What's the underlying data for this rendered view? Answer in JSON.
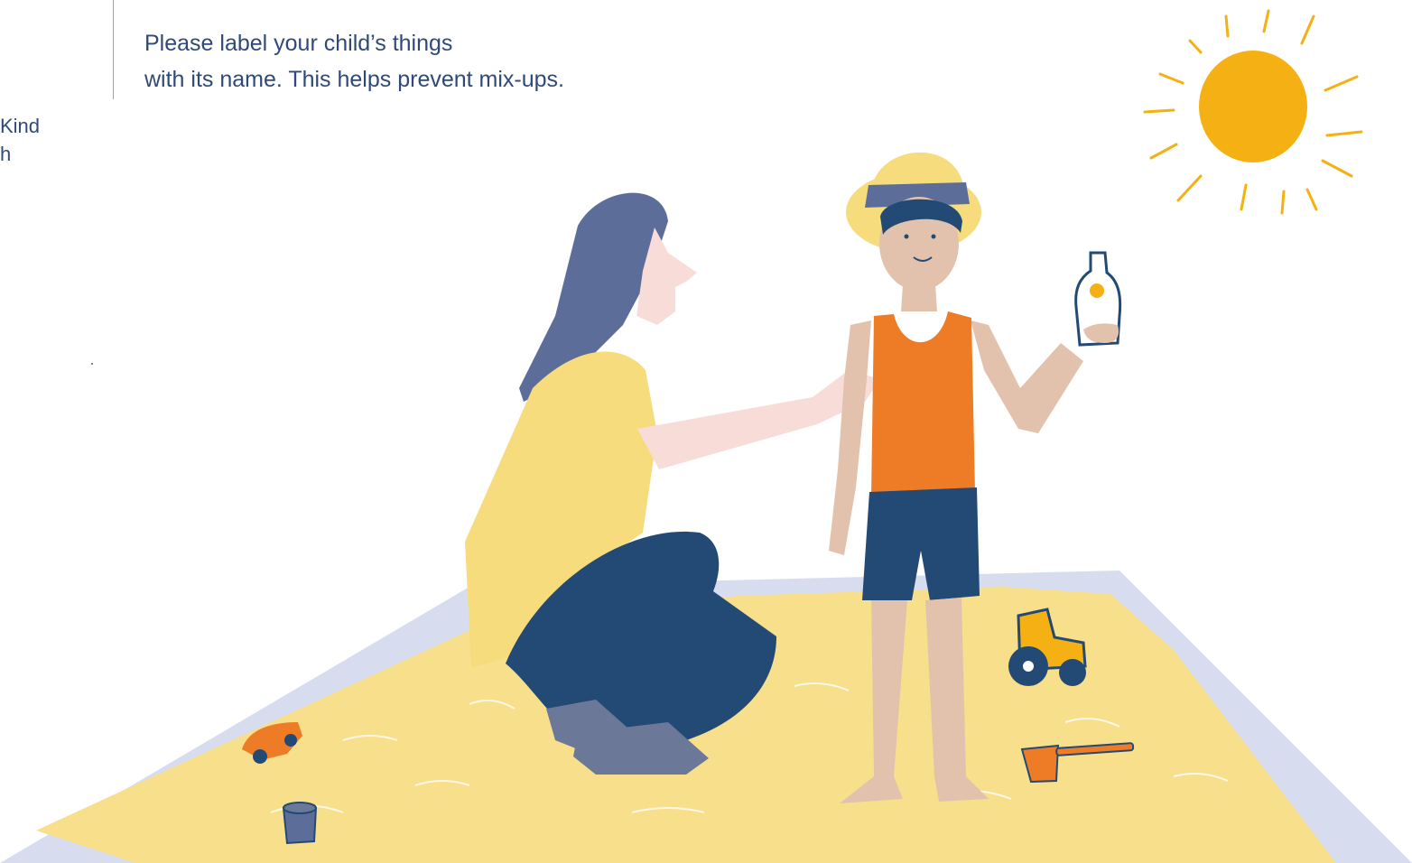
{
  "sidebar": {
    "line1": "Kind",
    "line2": "h"
  },
  "notice": {
    "line1": "Please label your child’s things",
    "line2": "with its name. This helps prevent mix-ups."
  },
  "colors": {
    "text": "#2f4a78",
    "sand": "#f7df8c",
    "sandbox_border": "#d7dcef",
    "sun": "#f5b014",
    "shirt_yellow": "#f6dc7d",
    "navy": "#234a75",
    "tank_orange": "#ee7b25",
    "skin_child": "#e3c2ad",
    "skin_adult": "#f8dcd8",
    "hair": "#5d6d9a",
    "socks": "#6c7898"
  }
}
